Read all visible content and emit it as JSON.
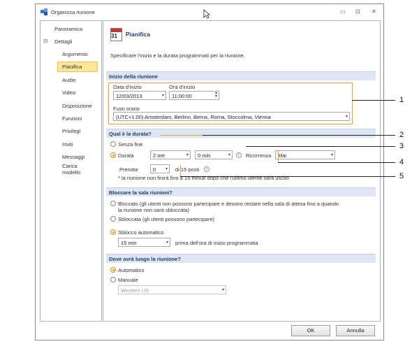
{
  "window": {
    "title": "Organizza riunione",
    "minimize_glyph": "▭",
    "restore_glyph": "⊡",
    "close_glyph": "✕"
  },
  "sidebar": {
    "items": [
      {
        "label": "Panoramica"
      },
      {
        "label": "Dettagli"
      },
      {
        "label": "Argomento"
      },
      {
        "label": "Pianifica"
      },
      {
        "label": "Audio"
      },
      {
        "label": "Video"
      },
      {
        "label": "Disposizione"
      },
      {
        "label": "Funzioni"
      },
      {
        "label": "Privilegi"
      },
      {
        "label": "Inviti"
      },
      {
        "label": "Messaggi"
      },
      {
        "label": "Carica"
      },
      {
        "label": "modello"
      }
    ],
    "expander": "⊟"
  },
  "page": {
    "title": "Pianifica",
    "calendar_number": "31",
    "description": "Specificare l'inizio e la durata programmati per la riunione."
  },
  "inizio": {
    "header": "Inizio della riunione",
    "date_label": "Data d'inizio",
    "date_value": "12/03/2013",
    "time_label": "Ora d'inizio",
    "time_value": "11:00:00",
    "timezone_label": "Fuso orario",
    "timezone_value": "(UTC+1.00) Amsterdam, Berlino, Berna, Roma, Stoccolma, Vienna"
  },
  "durata": {
    "header": "Qual è la durata?",
    "no_end_label": "Senza fine",
    "duration_label": "Durata",
    "hours_value": "2 ore",
    "minutes_value": "0 min",
    "recurrence_label": "Ricorrenza",
    "recurrence_value": "Mai",
    "reserve_label": "Prenota",
    "reserve_value": "0",
    "reserve_suffix": "di 15 posti",
    "note": "* la riunione non finirà fino a 15 minuti dopo che l'ultimo utente sarà uscito"
  },
  "sala": {
    "header": "Bloccare la sala riunioni?",
    "locked_line1": "Bloccato (gli utenti non possono partecipare e devono restare nella sala di attesa fino a quando",
    "locked_line2": "la riunione non sarà sbloccata)",
    "unlocked_label": "Sbloccata (gli utenti possono partecipare)",
    "auto_label": "Sblocco automatico",
    "auto_value": "15 min",
    "auto_suffix": "prima dell'ora di inizio programmata"
  },
  "luogo": {
    "header": "Dove avrà luogo la riunione?",
    "auto_label": "Automatico",
    "manual_label": "Manuale",
    "region_value": "Western US"
  },
  "buttons": {
    "ok": "OK",
    "cancel": "Annulla"
  },
  "callouts": [
    "1",
    "2",
    "3",
    "4",
    "5"
  ],
  "colors": {
    "accent": "#e8a33d",
    "header_text": "#1f3e6e",
    "section_bg": "#dde6f2",
    "selected_bg": "#fde79a"
  }
}
